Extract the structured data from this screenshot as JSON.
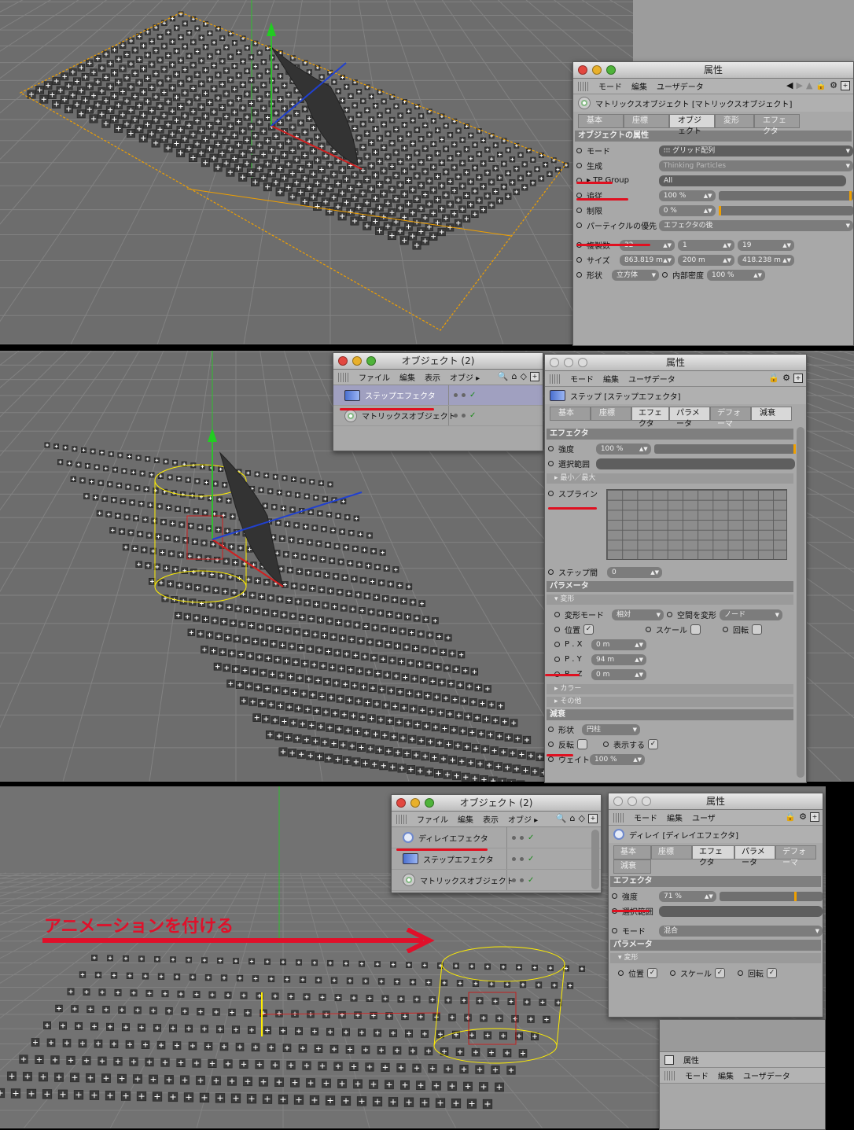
{
  "panel1": {
    "attr_title": "属性",
    "menu": [
      "モード",
      "編集",
      "ユーザデータ"
    ],
    "object_title": "マトリックスオブジェクト [マトリックスオブジェクト]",
    "tabs": [
      "基本",
      "座標",
      "オブジェクト",
      "変形",
      "エフェクタ"
    ],
    "active_tab": "オブジェクト",
    "section": "オブジェクトの属性",
    "mode_label": "モード",
    "mode_value": "グリッド配列",
    "gen_label": "生成",
    "gen_value": "Thinking Particles",
    "tp_label": "TP Group",
    "tp_value": "All",
    "track_label": "追従",
    "track_value": "100 %",
    "limit_label": "制限",
    "limit_value": "0 %",
    "priority_label": "パーティクルの優先",
    "priority_value": "エフェクタの後",
    "count_label": "複製数",
    "count_values": [
      "32",
      "1",
      "19"
    ],
    "size_label": "サイズ",
    "size_values": [
      "863.819 m",
      "200 m",
      "418.238 m"
    ],
    "shape_label": "形状",
    "shape_value": "立方体",
    "density_label": "内部密度",
    "density_value": "100 %"
  },
  "panel2": {
    "obj_title": "オブジェクト (2)",
    "obj_menu": [
      "ファイル",
      "編集",
      "表示",
      "オブジ"
    ],
    "obj_items": [
      "ステップエフェクタ",
      "マトリックスオブジェクト"
    ],
    "attr_title": "属性",
    "menu": [
      "モード",
      "編集",
      "ユーザデータ"
    ],
    "object_title": "ステップ [ステップエフェクタ]",
    "tabs": [
      "基本",
      "座標",
      "エフェクタ",
      "パラメータ",
      "デフォーマ",
      "減衰"
    ],
    "active_tab": "エフェクタ",
    "sec_effector": "エフェクタ",
    "strength_label": "強度",
    "strength_value": "100 %",
    "selection_label": "選択範囲",
    "minmax_label": "最小／最大",
    "spline_label": "スプライン",
    "step_label": "ステップ間",
    "step_value": "0",
    "sec_param": "パラメータ",
    "sub_transform": "変形",
    "tmode_label": "変形モード",
    "tmode_value": "相対",
    "space_label": "空間を変形",
    "space_value": "ノード",
    "pos_label": "位置",
    "scale_label": "スケール",
    "rot_label": "回転",
    "px_label": "P . X",
    "px_value": "0 m",
    "py_label": "P . Y",
    "py_value": "94 m",
    "pz_label": "P . Z",
    "pz_value": "0 m",
    "sub_color": "カラー",
    "sub_other": "その他",
    "sec_falloff": "減衰",
    "fshape_label": "形状",
    "fshape_value": "円柱",
    "invert_label": "反転",
    "show_label": "表示する",
    "weight_label": "ウェイト",
    "weight_value": "100 %"
  },
  "panel3": {
    "obj_title": "オブジェクト (2)",
    "obj_menu": [
      "ファイル",
      "編集",
      "表示",
      "オブジ"
    ],
    "obj_items": [
      "ディレイエフェクタ",
      "ステップエフェクタ",
      "マトリックスオブジェクト"
    ],
    "attr_title": "属性",
    "menu": [
      "モード",
      "編集",
      "ユーザ"
    ],
    "object_title": "ディレイ [ディレイエフェクタ]",
    "tabs": [
      "基本",
      "座標",
      "エフェクタ",
      "パラメータ",
      "デフォーマ",
      "減衰"
    ],
    "active_tab": "エフェクタ",
    "sec_effector": "エフェクタ",
    "strength_label": "強度",
    "strength_value": "71 %",
    "selection_label": "選択範囲",
    "mode_label": "モード",
    "mode_value": "混合",
    "sec_param": "パラメータ",
    "sub_transform": "変形",
    "pos_label": "位置",
    "scale_label": "スケール",
    "rot_label": "回転",
    "bottom_title": "属性",
    "bottom_menu": [
      "モード",
      "編集",
      "ユーザデータ"
    ],
    "annotation": "アニメーションを付ける"
  },
  "colors": {
    "viewport": "#6d6d6d",
    "panel": "#a8a8a8",
    "highlight_red": "#e01020",
    "selection_orange": "#f0a000",
    "falloff_yellow": "#ffee00"
  }
}
